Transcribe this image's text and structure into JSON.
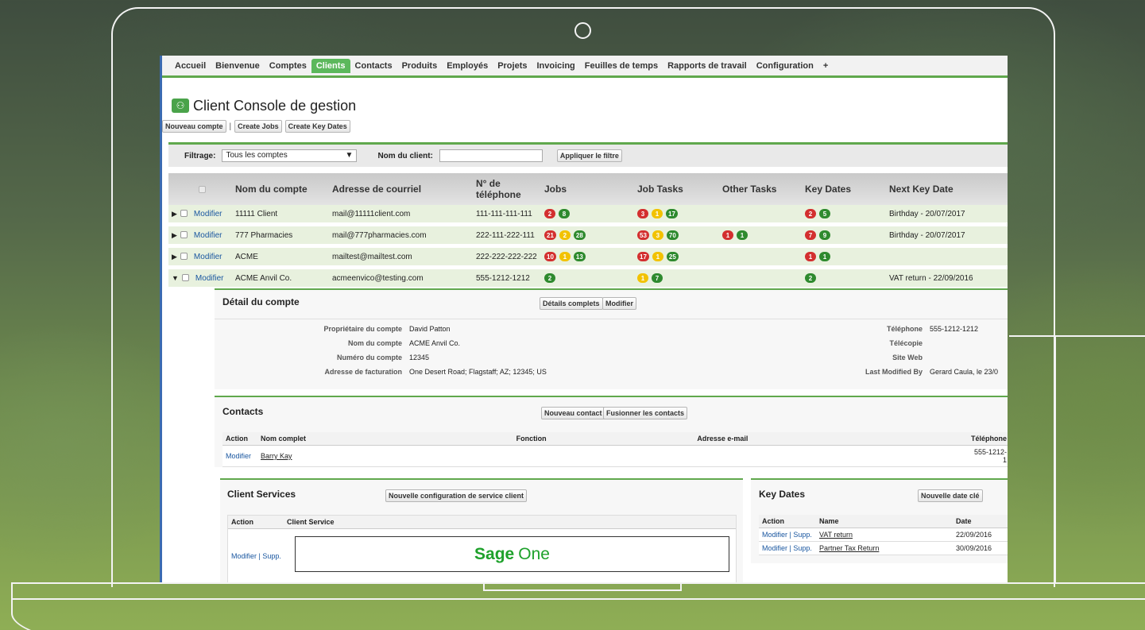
{
  "nav": {
    "tabs": [
      "Accueil",
      "Bienvenue",
      "Comptes",
      "Clients",
      "Contacts",
      "Produits",
      "Employés",
      "Projets",
      "Invoicing",
      "Feuilles de temps",
      "Rapports de travail",
      "Configuration",
      "+"
    ],
    "active": "Clients"
  },
  "page": {
    "title": "Client Console de gestion",
    "buttons": {
      "new_account": "Nouveau compte",
      "separator": "|",
      "create_jobs": "Create Jobs",
      "create_key_dates": "Create Key Dates"
    }
  },
  "filter": {
    "label": "Filtrage:",
    "select_value": "Tous les comptes",
    "client_label": "Nom du client:",
    "client_value": "",
    "apply": "Appliquer le filtre"
  },
  "grid": {
    "columns": [
      "Nom du compte",
      "Adresse de courriel",
      "N° de téléphone",
      "Jobs",
      "Job Tasks",
      "Other Tasks",
      "Key Dates",
      "Next Key Date"
    ],
    "edit_label": "Modifier",
    "rows": [
      {
        "name": "11111 Client",
        "email": "mail@11111client.com",
        "phone": "111-111-111-111",
        "jobs": [
          {
            "n": "2",
            "c": "red"
          },
          {
            "n": "8",
            "c": "green"
          }
        ],
        "job_tasks": [
          {
            "n": "3",
            "c": "red"
          },
          {
            "n": "1",
            "c": "yellow"
          },
          {
            "n": "17",
            "c": "green"
          }
        ],
        "other_tasks": [],
        "key_dates": [
          {
            "n": "2",
            "c": "red"
          },
          {
            "n": "5",
            "c": "green"
          }
        ],
        "next": "Birthday - 20/07/2017",
        "expanded": false
      },
      {
        "name": "777 Pharmacies",
        "email": "mail@777pharmacies.com",
        "phone": "222-111-222-111",
        "jobs": [
          {
            "n": "21",
            "c": "red"
          },
          {
            "n": "2",
            "c": "yellow"
          },
          {
            "n": "28",
            "c": "green"
          }
        ],
        "job_tasks": [
          {
            "n": "53",
            "c": "red"
          },
          {
            "n": "3",
            "c": "yellow"
          },
          {
            "n": "70",
            "c": "green"
          }
        ],
        "other_tasks": [
          {
            "n": "1",
            "c": "red"
          },
          {
            "n": "1",
            "c": "green"
          }
        ],
        "key_dates": [
          {
            "n": "7",
            "c": "red"
          },
          {
            "n": "9",
            "c": "green"
          }
        ],
        "next": "Birthday - 20/07/2017",
        "expanded": false
      },
      {
        "name": "ACME",
        "email": "mailtest@mailtest.com",
        "phone": "222-222-222-222",
        "jobs": [
          {
            "n": "10",
            "c": "red"
          },
          {
            "n": "1",
            "c": "yellow"
          },
          {
            "n": "13",
            "c": "green"
          }
        ],
        "job_tasks": [
          {
            "n": "17",
            "c": "red"
          },
          {
            "n": "1",
            "c": "yellow"
          },
          {
            "n": "25",
            "c": "green"
          }
        ],
        "other_tasks": [],
        "key_dates": [
          {
            "n": "1",
            "c": "red"
          },
          {
            "n": "1",
            "c": "green"
          }
        ],
        "next": "",
        "expanded": false
      },
      {
        "name": "ACME Anvil Co.",
        "email": "acmeenvico@testing.com",
        "phone": "555-1212-1212",
        "jobs": [
          {
            "n": "2",
            "c": "green"
          }
        ],
        "job_tasks": [
          {
            "n": "1",
            "c": "yellow"
          },
          {
            "n": "7",
            "c": "green"
          }
        ],
        "other_tasks": [],
        "key_dates": [
          {
            "n": "2",
            "c": "green"
          }
        ],
        "next": "VAT return - 22/09/2016",
        "expanded": true
      }
    ]
  },
  "account_detail": {
    "title": "Détail du compte",
    "btn_full": "Détails complets",
    "btn_edit": "Modifier",
    "left": [
      {
        "k": "Propriétaire du compte",
        "v": "David Patton"
      },
      {
        "k": "Nom du compte",
        "v": "ACME Anvil Co."
      },
      {
        "k": "Numéro du compte",
        "v": "12345"
      },
      {
        "k": "Adresse de facturation",
        "v": "One Desert Road; Flagstaff; AZ; 12345; US"
      }
    ],
    "right": [
      {
        "k": "Téléphone",
        "v": "555-1212-1212"
      },
      {
        "k": "Télécopie",
        "v": ""
      },
      {
        "k": "Site Web",
        "v": ""
      },
      {
        "k": "Last Modified By",
        "v": "Gerard Caula, le 23/0"
      }
    ]
  },
  "contacts": {
    "title": "Contacts",
    "btn_new": "Nouveau contact",
    "btn_merge": "Fusionner les contacts",
    "columns": [
      "Action",
      "Nom complet",
      "Fonction",
      "Adresse e-mail",
      "Téléphone"
    ],
    "rows": [
      {
        "action": "Modifier",
        "name": "Barry Kay",
        "fonction": "",
        "email": "",
        "phone": "555-1212-1"
      }
    ]
  },
  "client_services": {
    "title": "Client Services",
    "btn_new": "Nouvelle configuration de service client",
    "columns": [
      "Action",
      "Client Service"
    ],
    "row_action": "Modifier | Supp.",
    "logo_word1": "Sage",
    "logo_word2": "One"
  },
  "key_dates": {
    "title": "Key Dates",
    "btn_new": "Nouvelle date clé",
    "columns": [
      "Action",
      "Name",
      "Date"
    ],
    "rows": [
      {
        "action": "Modifier | Supp.",
        "name": "VAT return",
        "date": "22/09/2016"
      },
      {
        "action": "Modifier | Supp.",
        "name": "Partner Tax Return",
        "date": "30/09/2016"
      }
    ]
  }
}
